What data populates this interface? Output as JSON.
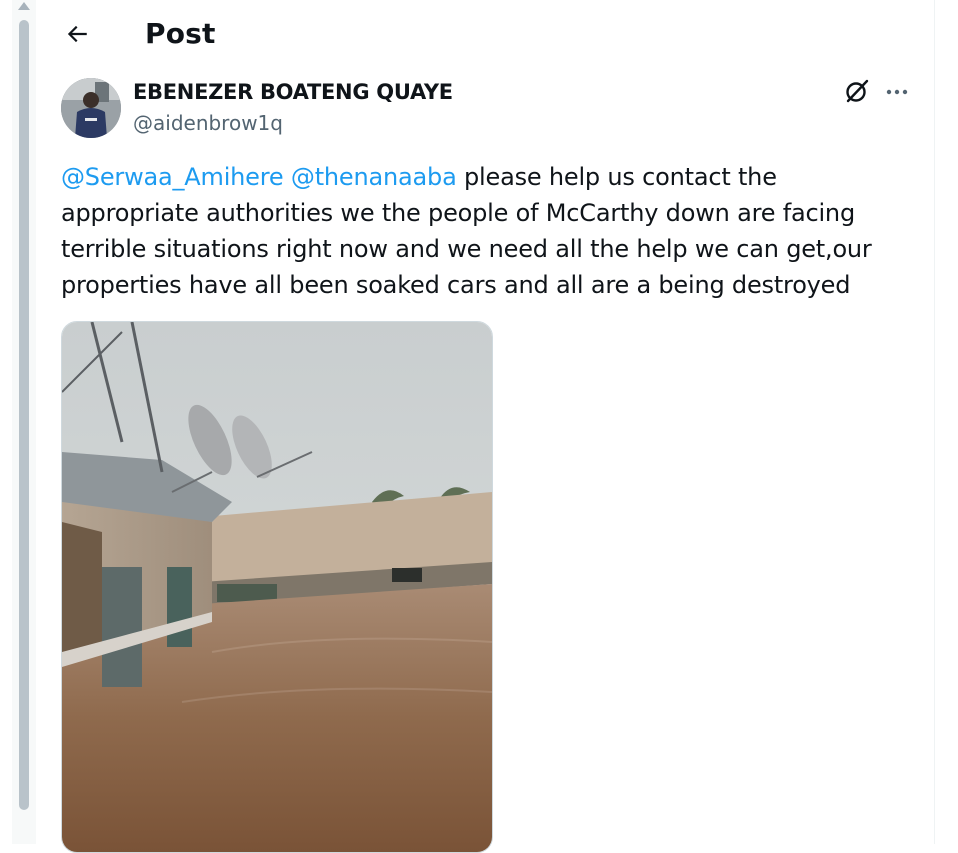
{
  "header": {
    "back_icon": "arrow-left-icon",
    "title": "Post"
  },
  "post": {
    "author": {
      "name": "EBENEZER BOATENG QUAYE",
      "handle": "@aidenbrow1q",
      "avatar_icon": "user-avatar"
    },
    "actions": {
      "grok_icon": "grok-icon",
      "more_icon": "more-horizontal-icon"
    },
    "mentions": [
      "@Serwaa_Amihere",
      "@thenanaaba"
    ],
    "body_text": " please help us contact the appropriate authorities we the people of McCarthy down are facing terrible situations right now and we need all the help we can get,our properties have all been soaked cars and all are a being destroyed",
    "media": {
      "type": "image",
      "subject": "flooded-residential-street-photo"
    }
  },
  "colors": {
    "link": "#1d9bf0",
    "text": "#0f1419",
    "secondary_text": "#536471",
    "border": "#cfd9de"
  }
}
